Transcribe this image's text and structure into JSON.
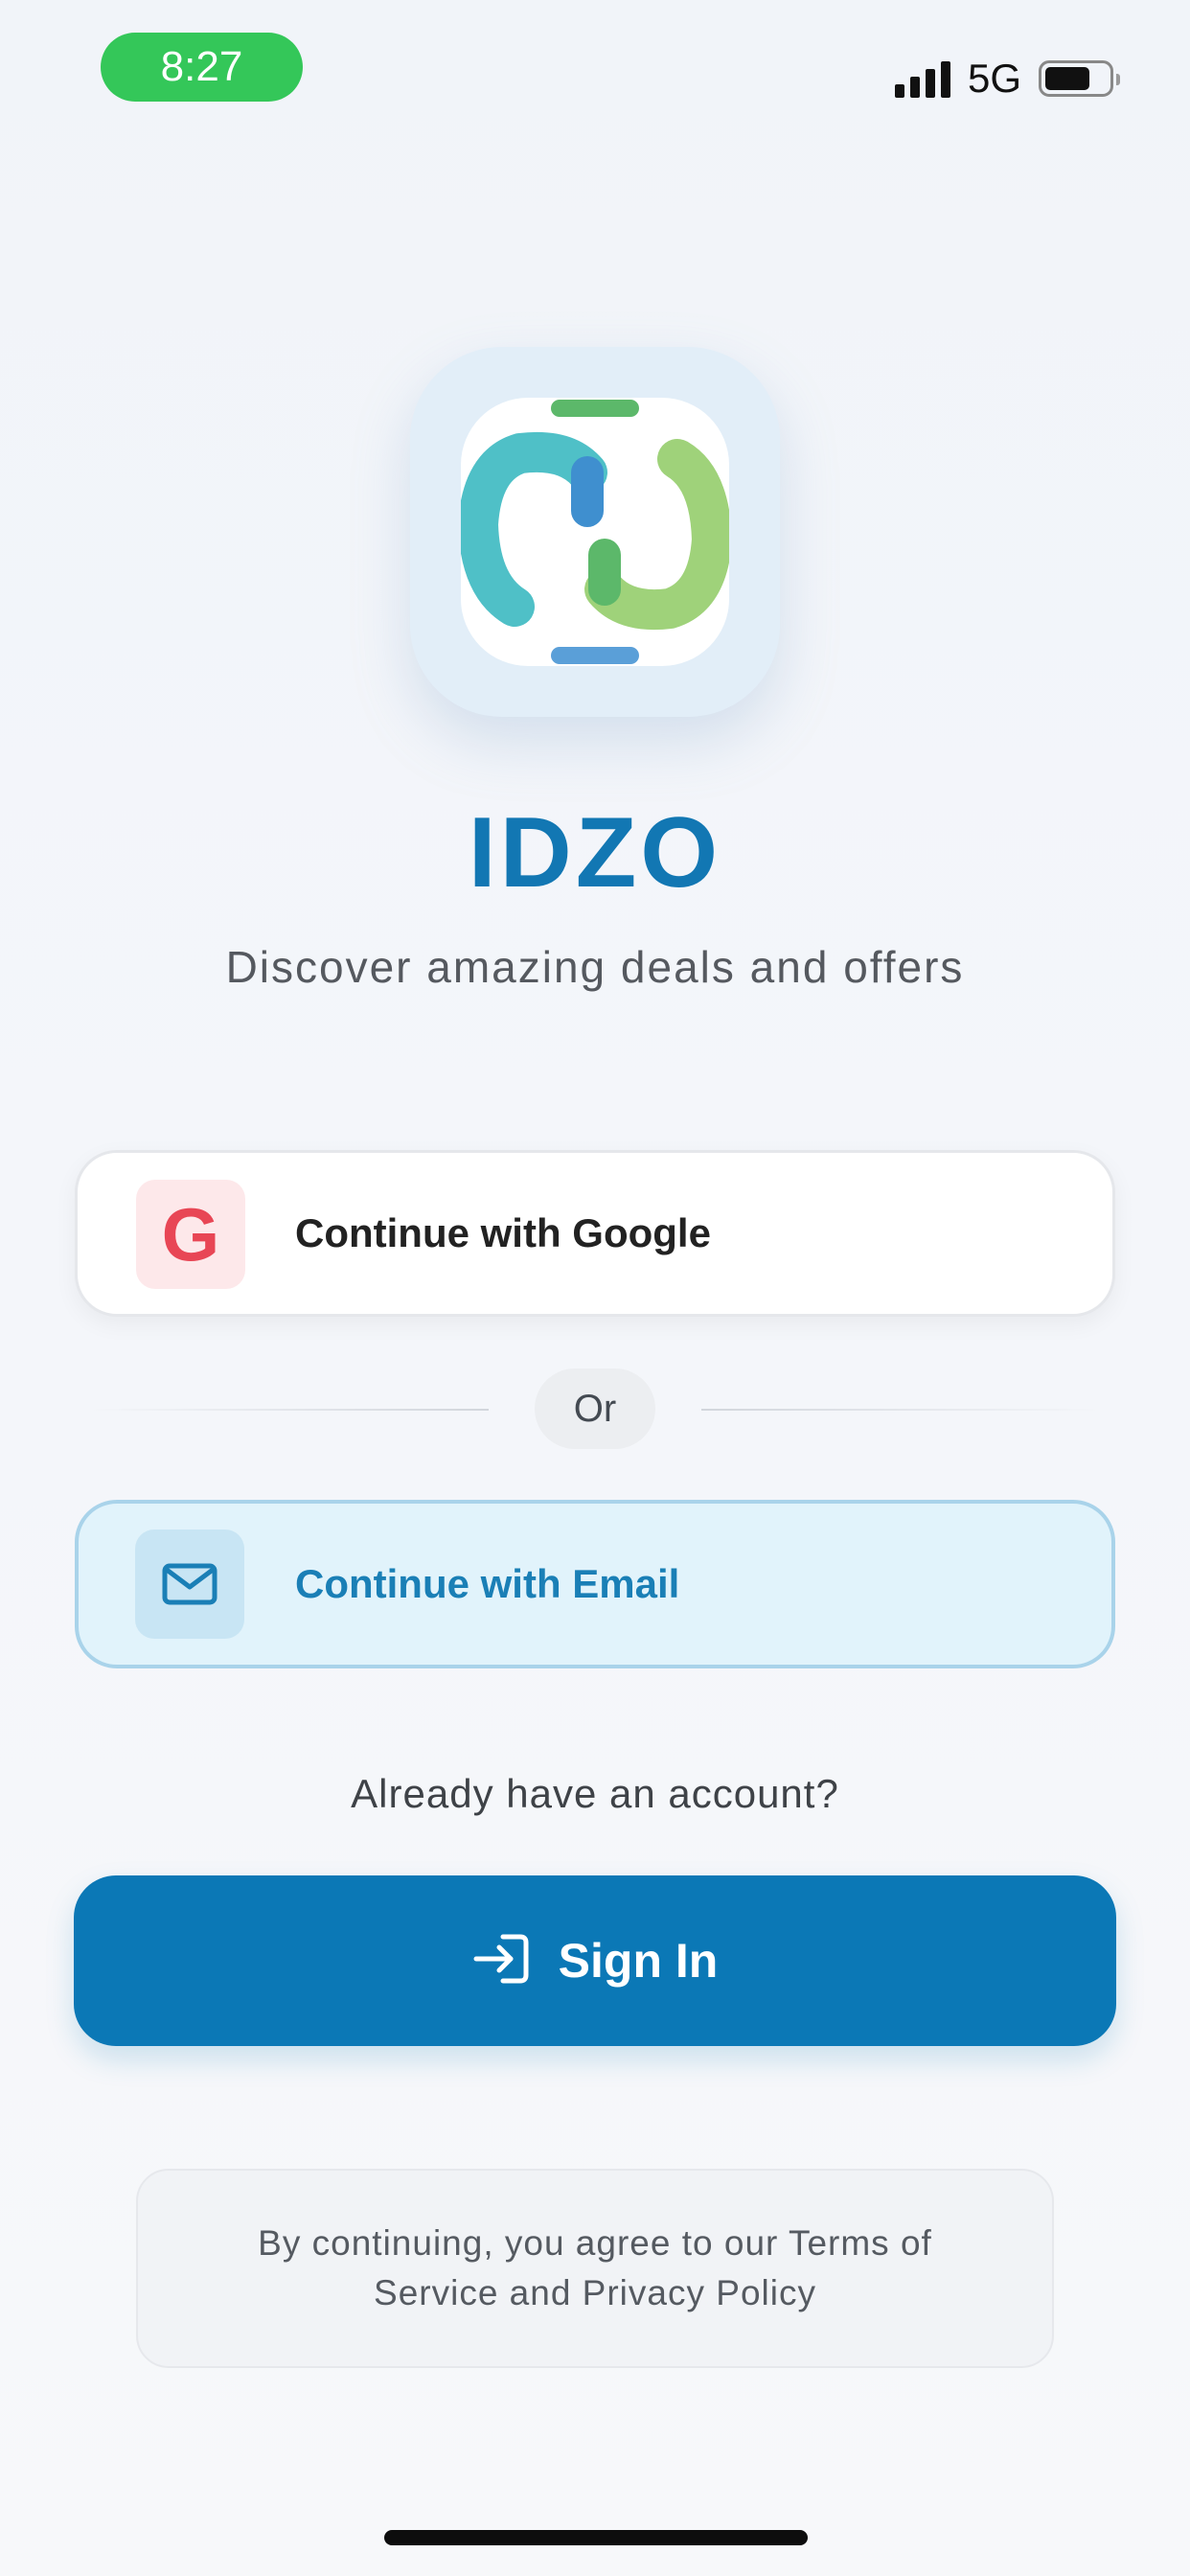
{
  "status_bar": {
    "time": "8:27",
    "network": "5G",
    "signal_icon": "cellular-signal-icon",
    "battery_icon": "battery-icon"
  },
  "logo": {
    "icon": "idzo-logo-icon",
    "colors": {
      "teal": "#4fc0c7",
      "green": "#9fd27a",
      "bar_green": "#5cb86a",
      "bar_blue": "#5a9fd8",
      "frame": "#e2eef8"
    }
  },
  "app": {
    "title": "IDZO",
    "tagline": "Discover amazing deals and offers"
  },
  "google_button": {
    "label": "Continue with Google",
    "icon": "google-g-icon",
    "icon_glyph": "G",
    "icon_color": "#e84655"
  },
  "divider": {
    "label": "Or"
  },
  "email_button": {
    "label": "Continue with Email",
    "icon": "envelope-icon",
    "accent_color": "#1a7fb6"
  },
  "account_prompt": "Already have an account?",
  "signin_button": {
    "label": "Sign In",
    "icon": "login-arrow-icon",
    "color": "#0b78b6"
  },
  "terms": {
    "text": "By continuing, you agree to our Terms of Service and Privacy Policy"
  }
}
